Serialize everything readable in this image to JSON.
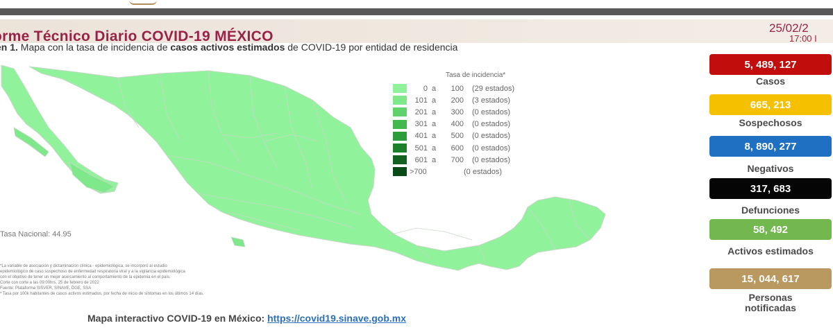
{
  "header": {
    "title": "orme Técnico Diario COVID-19 MÉXICO",
    "date": "25/02/2",
    "time": "17:00 I",
    "subtitle_prefix": "en 1.",
    "subtitle_text1": " Mapa con la tasa de incidencia de ",
    "subtitle_bold": "casos activos estimados",
    "subtitle_text2": " de COVID-19 por entidad de residencia"
  },
  "legend": {
    "title": "Tasa de incidencia*",
    "rows": [
      {
        "from": "0",
        "to": "100",
        "count": "(29 estados)",
        "color": "#90f29a"
      },
      {
        "from": "101",
        "to": "200",
        "count": "(3 estados)",
        "color": "#7ee88a"
      },
      {
        "from": "201",
        "to": "300",
        "count": "(0 estados)",
        "color": "#5fd26c"
      },
      {
        "from": "301",
        "to": "400",
        "count": "(0 estados)",
        "color": "#42b94f"
      },
      {
        "from": "401",
        "to": "500",
        "count": "(0 estados)",
        "color": "#2d9c3a"
      },
      {
        "from": "501",
        "to": "600",
        "count": "(0 estados)",
        "color": "#1e7f2a"
      },
      {
        "from": "601",
        "to": "700",
        "count": "(0 estados)",
        "color": "#126120"
      },
      {
        "label": ">700",
        "count": "(0 estados)",
        "color": "#0a4a16"
      }
    ],
    "connector": "a"
  },
  "map": {
    "tasa_nacional": "Tasa Nacional: 44.95",
    "base_color": "#90f29a",
    "highlight_color": "#7ee88a",
    "border_color": "#c8d8c8"
  },
  "notes": [
    "*La variable de asociación y dictaminación clínica - epidemiológica, se incorporó al estudio",
    "epidemiológico de caso sospechoso de enfermedad respiratoria viral y a la vigilancia epidemiológica",
    "con el objetivo de tener un mejor acercamiento al comportamiento de la epidemia en el país.",
    "Corte con corte a las 09:00hrs, 25 de febrero de 2022",
    "Fuente: Plataforma SISVER, SINAVE, DGE, SSA",
    "* Tasa por 100k habitantes de casos activos estimados, por fecha de inicio de síntomas en los últimos 14 días."
  ],
  "stats": [
    {
      "value": "5, 489, 127",
      "label": "Casos",
      "color": "#c20d0d",
      "text_color": "#ffffff"
    },
    {
      "value": "665, 213",
      "label": "Sospechosos",
      "color": "#f5c000",
      "text_color": "#ffffff"
    },
    {
      "value": "8, 890, 277",
      "label": "Negativos",
      "color": "#1f6fc2",
      "text_color": "#ffffff"
    },
    {
      "value": "317, 683",
      "label": "Defunciones",
      "color": "#050505",
      "text_color": "#ffffff"
    },
    {
      "value": "58, 492",
      "label": "Activos estimados",
      "color": "#72b84f",
      "text_color": "#ffffff"
    },
    {
      "value": "15, 044, 617",
      "label": "Personas notificadas",
      "color": "#b99960",
      "text_color": "#ffffff"
    }
  ],
  "footer": {
    "label": "Mapa interactivo COVID-19 en México: ",
    "link": "https://covid19.sinave.gob.mx"
  }
}
